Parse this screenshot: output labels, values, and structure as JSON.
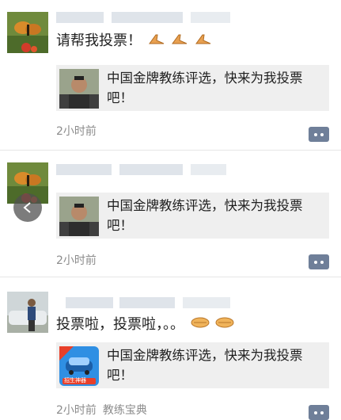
{
  "posts": [
    {
      "text": "请帮我投票！",
      "emojis": [
        "pray-hands",
        "pray-hands",
        "pray-hands"
      ],
      "share_title": "中国金牌教练评选，快来为我投票吧！",
      "time": "2小时前",
      "source": ""
    },
    {
      "text": "",
      "emojis": [],
      "share_title": "中国金牌教练评选，快来为我投票吧！",
      "time": "2小时前",
      "source": ""
    },
    {
      "text": "投票啦，投票啦，。。",
      "emojis": [
        "handshake",
        "handshake"
      ],
      "share_title": "中国金牌教练评选，快来为我投票吧！",
      "time": "2小时前",
      "source": "教练宝典"
    }
  ],
  "share_app_badge": "招生神器",
  "icons": [
    "comment-icon",
    "back-arrow-icon"
  ],
  "colors": {
    "comment_button": "#6f7f99",
    "share_bg": "#efefef",
    "meta_text": "#8c8c8c"
  }
}
